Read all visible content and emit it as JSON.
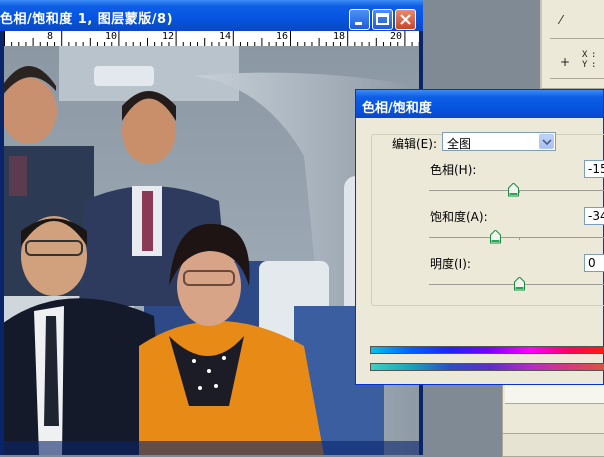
{
  "document": {
    "title": "色相/饱和度 1, 图层蒙版/8)",
    "ruler_marks": [
      "8",
      "10",
      "12",
      "14",
      "16",
      "18",
      "20"
    ]
  },
  "dialog": {
    "title": "色相/饱和度",
    "edit_label": "编辑(E):",
    "edit_value": "全图",
    "hue": {
      "label": "色相(H):",
      "value": "-15",
      "slider_fraction": 0.47
    },
    "saturation": {
      "label": "饱和度(A):",
      "value": "-34",
      "slider_fraction": 0.37
    },
    "lightness": {
      "label": "明度(I):",
      "value": "0",
      "slider_fraction": 0.5
    }
  },
  "tool_panel": {
    "xy_label_x": "X",
    "xy_label_y": "Y"
  },
  "colors": {
    "titlebar": "#0654e0",
    "dialog_bg": "#ece9d8",
    "close_button": "#c8452c",
    "jacket_orange": "#e88a16"
  },
  "icons": [
    "minimize-icon",
    "maximize-icon",
    "close-icon",
    "dropdown-arrow-icon",
    "eyedropper-icon",
    "crosshair-icon"
  ]
}
